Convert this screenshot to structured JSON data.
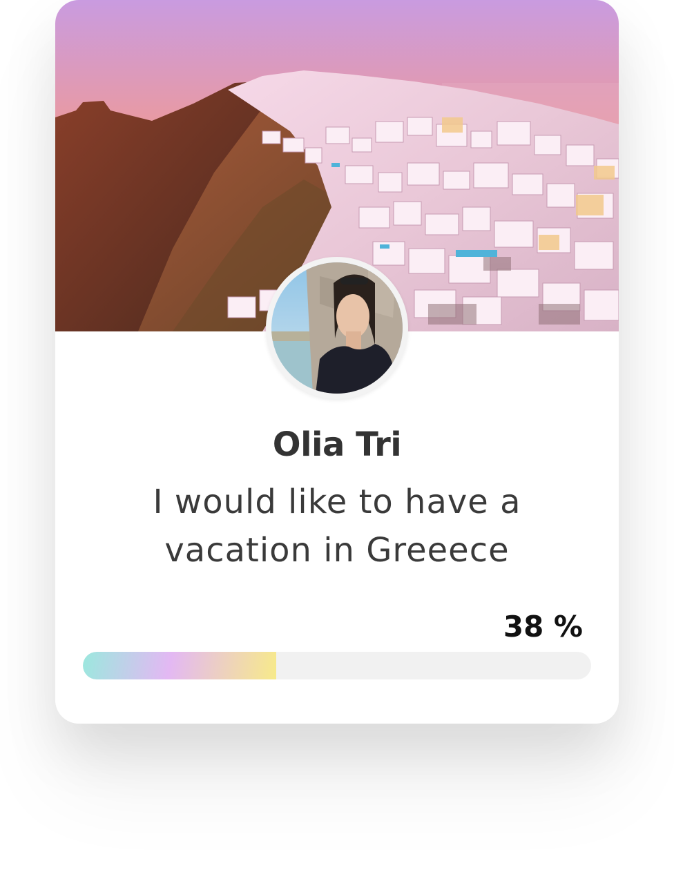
{
  "profile": {
    "name": "Olia Tri",
    "wish": "I would like to have a vacation in Greeece"
  },
  "progress": {
    "label": "38 %",
    "fraction": 0.38
  },
  "images": {
    "cover": "santorini-sunset-photo",
    "avatar": "profile-photo"
  },
  "colors": {
    "progress_gradient": [
      "#9be8de",
      "#e3b8f3",
      "#f7ea8a"
    ],
    "track": "#f1f1f1",
    "name_text": "#333333"
  }
}
